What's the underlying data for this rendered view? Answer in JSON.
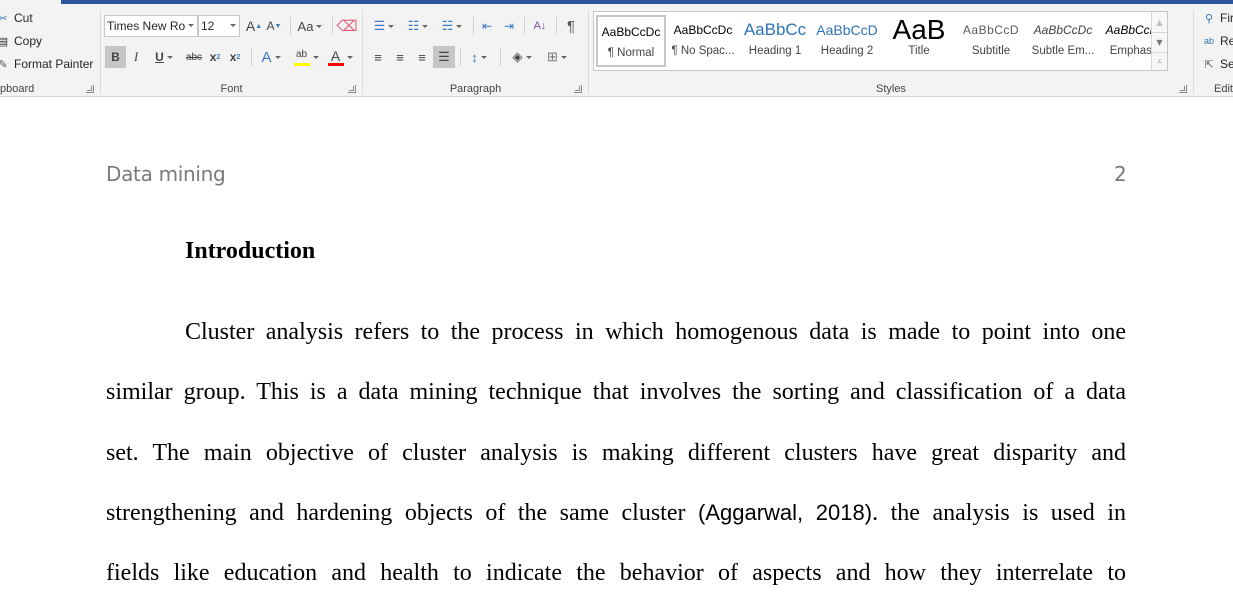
{
  "ribbon": {
    "clipboard": {
      "label": "pboard",
      "cut": "Cut",
      "copy": "Copy",
      "format_painter": "Format Painter"
    },
    "font": {
      "label": "Font",
      "font_name": "Times New Ro",
      "font_size": "12",
      "grow": "A",
      "shrink": "A",
      "change_case": "Aa",
      "bold": "B",
      "italic": "I",
      "underline": "U",
      "strike": "abc",
      "subscript": "x",
      "superscript": "x",
      "highlight_color": "#ffff00",
      "font_color": "#ff0000"
    },
    "paragraph": {
      "label": "Paragraph",
      "pilcrow": "¶"
    },
    "styles": {
      "label": "Styles",
      "items": [
        {
          "preview": "AaBbCcDc",
          "name": "¶ Normal",
          "selected": true
        },
        {
          "preview": "AaBbCcDc",
          "name": "¶ No Spac..."
        },
        {
          "preview": "AaBbCc",
          "name": "Heading 1"
        },
        {
          "preview": "AaBbCcD",
          "name": "Heading 2"
        },
        {
          "preview": "AaB",
          "name": "Title"
        },
        {
          "preview": "AaBbCcD",
          "name": "Subtitle"
        },
        {
          "preview": "AaBbCcDc",
          "name": "Subtle Em..."
        },
        {
          "preview": "AaBbCcDc",
          "name": "Emphasis"
        }
      ]
    },
    "editing": {
      "label": "Edit",
      "find": "Fir",
      "replace": "Re",
      "select": "Se"
    }
  },
  "document": {
    "header_title": "Data mining",
    "page_number": "2",
    "heading": "Introduction",
    "lines": [
      "Cluster analysis refers to the process in which homogenous data is made to point into one",
      "similar group. This is a data mining technique that involves the sorting and classification of a data",
      "set. The main objective of cluster analysis is making different clusters have great disparity and",
      "strengthening and hardening objects of the same cluster",
      "fields like education and health to indicate the behavior of aspects and how they interrelate to"
    ],
    "citation": "(Aggarwal, 2018)",
    "line4_tail": ". the analysis is used in"
  }
}
